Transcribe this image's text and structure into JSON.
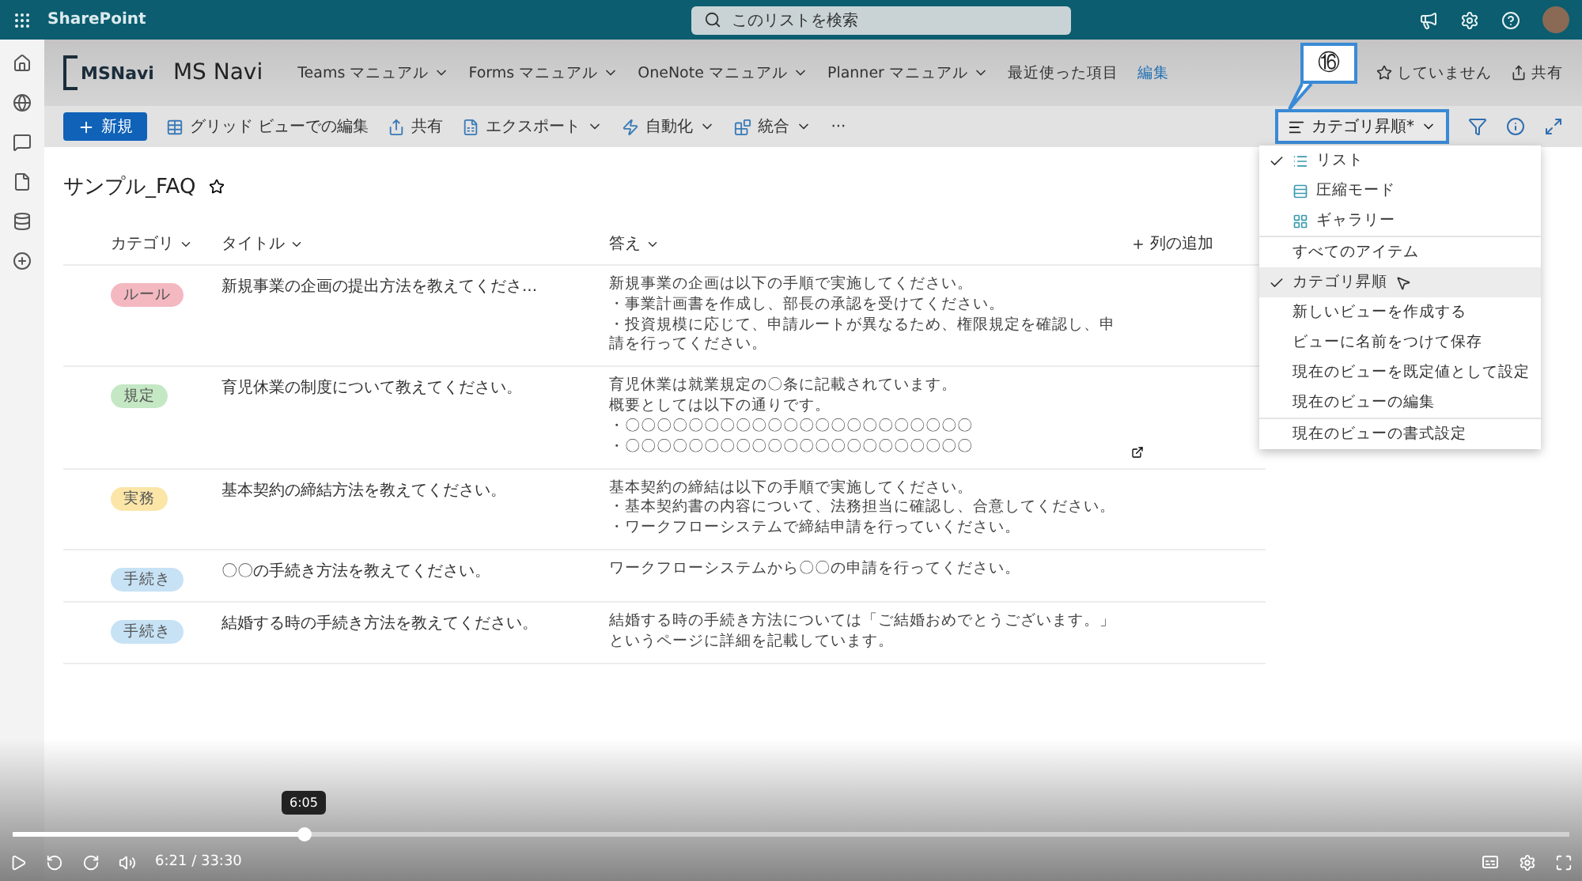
{
  "app_bar": {
    "brand": "SharePoint",
    "search": {
      "placeholder": "このリストを検索"
    }
  },
  "site": {
    "logo": "MSNavi",
    "name": "MS Navi",
    "nav": [
      {
        "label": "Teams マニュアル",
        "kind": "menu"
      },
      {
        "label": "Forms マニュアル",
        "kind": "menu"
      },
      {
        "label": "OneNote マニュアル",
        "kind": "menu"
      },
      {
        "label": "Planner マニュアル",
        "kind": "menu"
      },
      {
        "label": "最近使った項目",
        "kind": "plain"
      },
      {
        "label": "編集",
        "kind": "link"
      }
    ],
    "follow": "していません",
    "share": "共有"
  },
  "command_bar": {
    "items": [
      {
        "label": "新規",
        "kind": "primary"
      },
      {
        "label": "グリッド ビューでの編集",
        "kind": "plain"
      },
      {
        "label": "共有",
        "kind": "plain"
      },
      {
        "label": "エクスポート",
        "kind": "menu"
      },
      {
        "label": "自動化",
        "kind": "menu"
      },
      {
        "label": "統合",
        "kind": "menu"
      },
      {
        "label": "···",
        "kind": "more"
      }
    ],
    "view_button": "カテゴリ昇順*"
  },
  "annotation": {
    "number": "⑯"
  },
  "list": {
    "title": "サンプル_FAQ",
    "columns": [
      "カテゴリ",
      "タイトル",
      "答え"
    ],
    "add_column": "列の追加",
    "rows": [
      {
        "category": "ルール",
        "color": "#f4b8c1",
        "title": "新規事業の企画の提出方法を教えてくださ...",
        "answer": [
          "新規事業の企画は以下の手順で実施してください。",
          "・事業計画書を作成し、部長の承認を受けてください。",
          "・投資規模に応じて、申請ルートが異なるため、権限規定を確認し、申請を行ってください。"
        ]
      },
      {
        "category": "規定",
        "color": "#c4e8c4",
        "title": "育児休業の制度について教えてください。",
        "answer": [
          "育児休業は就業規定の〇条に記載されています。",
          "概要としては以下の通りです。",
          "・〇〇〇〇〇〇〇〇〇〇〇〇〇〇〇〇〇〇〇〇〇〇",
          "・〇〇〇〇〇〇〇〇〇〇〇〇〇〇〇〇〇〇〇〇〇〇"
        ],
        "expand": true
      },
      {
        "category": "実務",
        "color": "#fbe6a8",
        "title": "基本契約の締結方法を教えてください。",
        "answer": [
          "基本契約の締結は以下の手順で実施してください。",
          "・基本契約書の内容について、法務担当に確認し、合意してください。",
          "・ワークフローシステムで締結申請を行っていください。"
        ]
      },
      {
        "category": "手続き",
        "color": "#c7e2f5",
        "title": "〇〇の手続き方法を教えてください。",
        "answer": [
          "ワークフローシステムから〇〇の申請を行ってください。"
        ]
      },
      {
        "category": "手続き",
        "color": "#c7e2f5",
        "title": "結婚する時の手続き方法を教えてください。",
        "answer": [
          "結婚する時の手続き方法については「ご結婚おめでとうございます。」というページに詳細を記載しています。"
        ]
      }
    ]
  },
  "view_menu": {
    "groups": [
      [
        {
          "label": "リスト",
          "kind": "layout",
          "checked": true,
          "selected": false
        },
        {
          "label": "圧縮モード",
          "kind": "layout",
          "checked": false,
          "selected": false
        },
        {
          "label": "ギャラリー",
          "kind": "layout",
          "checked": false,
          "selected": false
        }
      ],
      [
        {
          "label": "すべてのアイテム",
          "kind": "view",
          "checked": false,
          "selected": false
        },
        {
          "label": "カテゴリ昇順",
          "kind": "view",
          "checked": true,
          "selected": true
        },
        {
          "label": "新しいビューを作成する",
          "kind": "action",
          "checked": false,
          "selected": false
        },
        {
          "label": "ビューに名前をつけて保存",
          "kind": "action",
          "checked": false,
          "selected": false
        },
        {
          "label": "現在のビューを既定値として設定",
          "kind": "action",
          "checked": false,
          "selected": false
        },
        {
          "label": "現在のビューの編集",
          "kind": "action",
          "checked": false,
          "selected": false
        }
      ],
      [
        {
          "label": "現在のビューの書式設定",
          "kind": "action",
          "checked": false,
          "selected": false
        }
      ]
    ]
  },
  "player": {
    "time": "6:21 / 33:30",
    "level": 0.187,
    "hover_time": "6:05"
  }
}
